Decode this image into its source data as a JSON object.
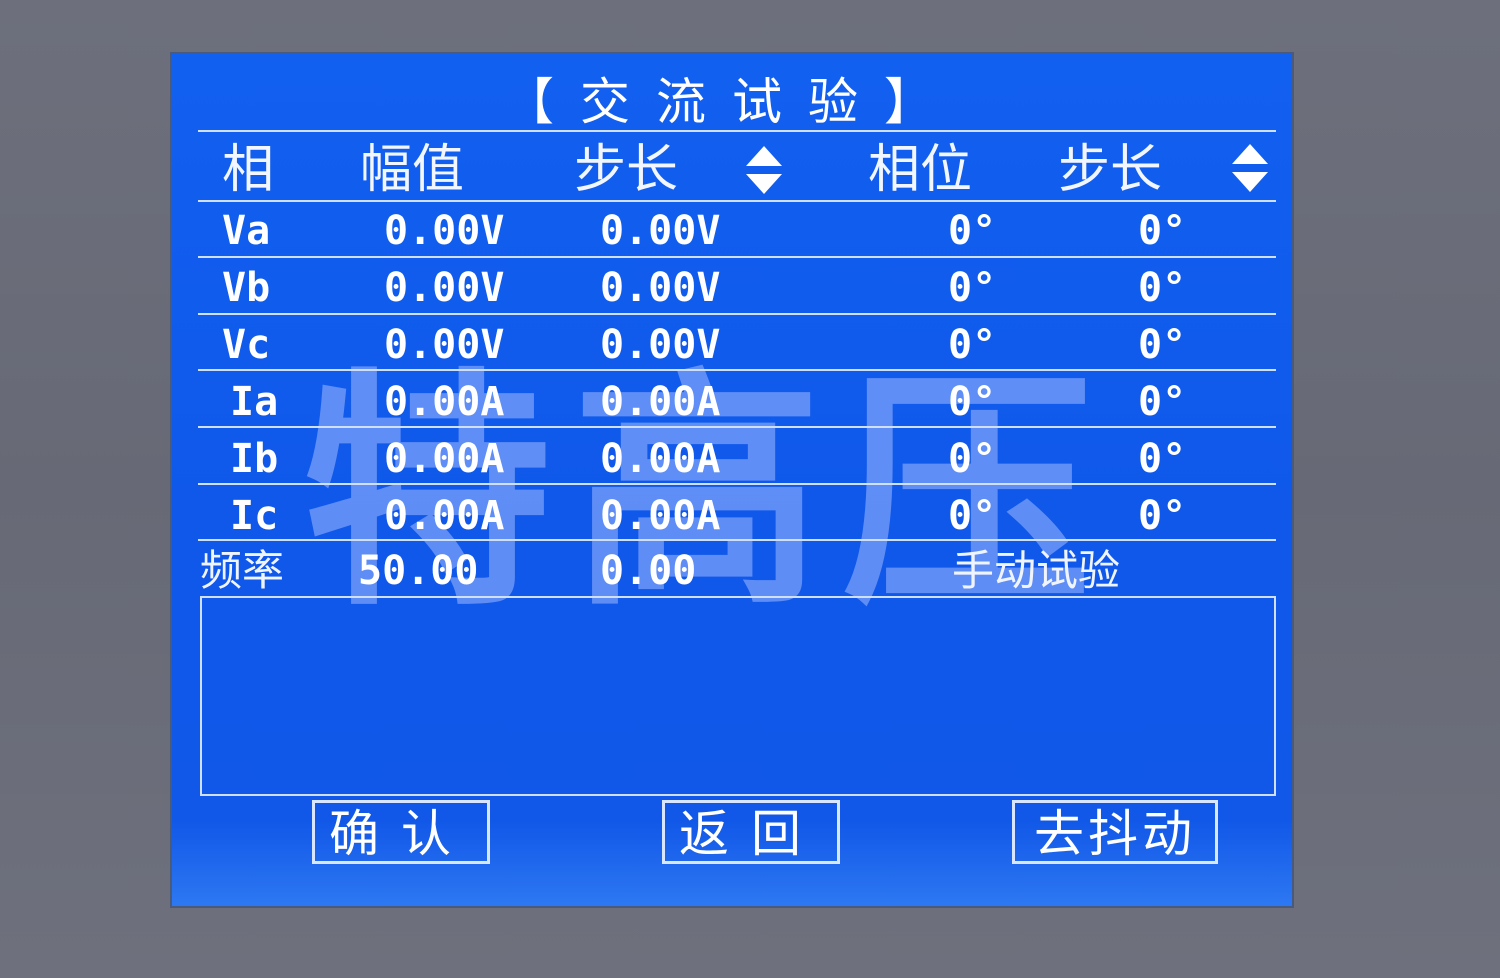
{
  "screen": {
    "title": "【交流试验】",
    "headers": {
      "phase": "相",
      "amplitude": "幅值",
      "amp_step": "步长",
      "phase_angle": "相位",
      "phase_step": "步长"
    },
    "rows": [
      {
        "label": "Va",
        "amplitude": "0.00V",
        "amp_step": "0.00V",
        "phase": "0°",
        "phase_step": "0°"
      },
      {
        "label": "Vb",
        "amplitude": "0.00V",
        "amp_step": "0.00V",
        "phase": "0°",
        "phase_step": "0°"
      },
      {
        "label": "Vc",
        "amplitude": "0.00V",
        "amp_step": "0.00V",
        "phase": "0°",
        "phase_step": "0°"
      },
      {
        "label": "Ia",
        "amplitude": "0.00A",
        "amp_step": "0.00A",
        "phase": "0°",
        "phase_step": "0°"
      },
      {
        "label": "Ib",
        "amplitude": "0.00A",
        "amp_step": "0.00A",
        "phase": "0°",
        "phase_step": "0°"
      },
      {
        "label": "Ic",
        "amplitude": "0.00A",
        "amp_step": "0.00A",
        "phase": "0°",
        "phase_step": "0°"
      }
    ],
    "frequency": {
      "label": "频率",
      "value": "50.00",
      "step": "0.00"
    },
    "mode": "手动试验",
    "buttons": {
      "confirm": "确认",
      "back": "返回",
      "debounce": "去抖动"
    },
    "watermark": "特高压",
    "icons": {
      "amp_step_adjust": "up-down-arrow-icon",
      "phase_step_adjust": "up-down-arrow-icon"
    },
    "colors": {
      "screen_bg": "#1260f0",
      "text": "#ffffff",
      "bezel": "#6b6e7a"
    }
  }
}
